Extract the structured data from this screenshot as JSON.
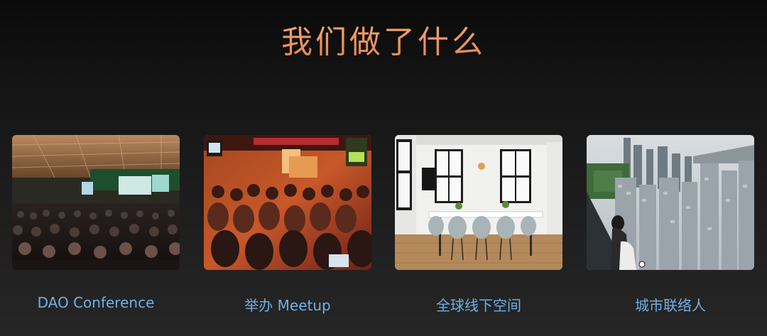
{
  "page": {
    "title": "我们做了什么"
  },
  "cards": [
    {
      "caption": "DAO Conference",
      "image": "conference-hall-photo"
    },
    {
      "caption": "举办 Meetup",
      "image": "meetup-crowd-photo"
    },
    {
      "caption": "全球线下空间",
      "image": "office-meeting-room-photo"
    },
    {
      "caption": "城市联络人",
      "image": "city-skyline-photo"
    }
  ],
  "colors": {
    "title": "#eb9560",
    "caption": "#6fb0e6",
    "background_top": "#0a0a0a",
    "background_bottom": "#262626"
  }
}
